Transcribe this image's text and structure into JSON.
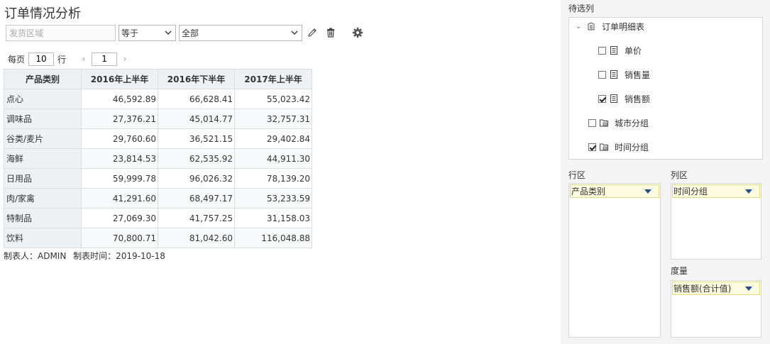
{
  "report": {
    "title": "订单情况分析",
    "filter": {
      "area_placeholder": "发货区域",
      "operator_value": "等于",
      "value_value": "全部"
    },
    "pager": {
      "per_page_label": "每页",
      "per_page_value": "10",
      "rows_label": "行",
      "prev_glyph": "‹",
      "page_value": "1",
      "next_glyph": "›"
    },
    "table": {
      "headers": [
        "产品类别",
        "2016年上半年",
        "2016年下半年",
        "2017年上半年"
      ],
      "rows": [
        [
          "点心",
          "46,592.89",
          "66,628.41",
          "55,023.42"
        ],
        [
          "调味品",
          "27,376.21",
          "45,014.77",
          "32,757.31"
        ],
        [
          "谷类/麦片",
          "29,760.60",
          "36,521.15",
          "29,402.84"
        ],
        [
          "海鲜",
          "23,814.53",
          "62,535.92",
          "44,911.30"
        ],
        [
          "日用品",
          "59,999.78",
          "96,026.32",
          "78,139.20"
        ],
        [
          "肉/家禽",
          "41,291.60",
          "68,497.17",
          "53,233.59"
        ],
        [
          "特制品",
          "27,069.30",
          "41,757.25",
          "31,158.03"
        ],
        [
          "饮料",
          "70,800.71",
          "81,042.60",
          "116,048.88"
        ]
      ]
    },
    "footer": {
      "maker": "制表人：ADMIN",
      "time": "制表时间：2019-10-18"
    }
  },
  "side": {
    "candidates_label": "待选列",
    "tree": {
      "root": "订单明细表",
      "items": [
        {
          "label": "单价",
          "checked": false
        },
        {
          "label": "销售量",
          "checked": false
        },
        {
          "label": "销售额",
          "checked": true
        }
      ],
      "groups": [
        {
          "label": "城市分组",
          "checked": false
        },
        {
          "label": "时间分组",
          "checked": true
        }
      ]
    },
    "row_zone_label": "行区",
    "row_field": "产品类别",
    "col_zone_label": "列区",
    "col_field": "时间分组",
    "measure_label": "度量",
    "measure_field": "销售额(合计值)"
  },
  "colors": {
    "header_bg": "#eef1f4",
    "pill_bg": "#fdfbe0",
    "pill_border": "#e6d97a",
    "dropdown_triangle": "#1f4f8f"
  }
}
